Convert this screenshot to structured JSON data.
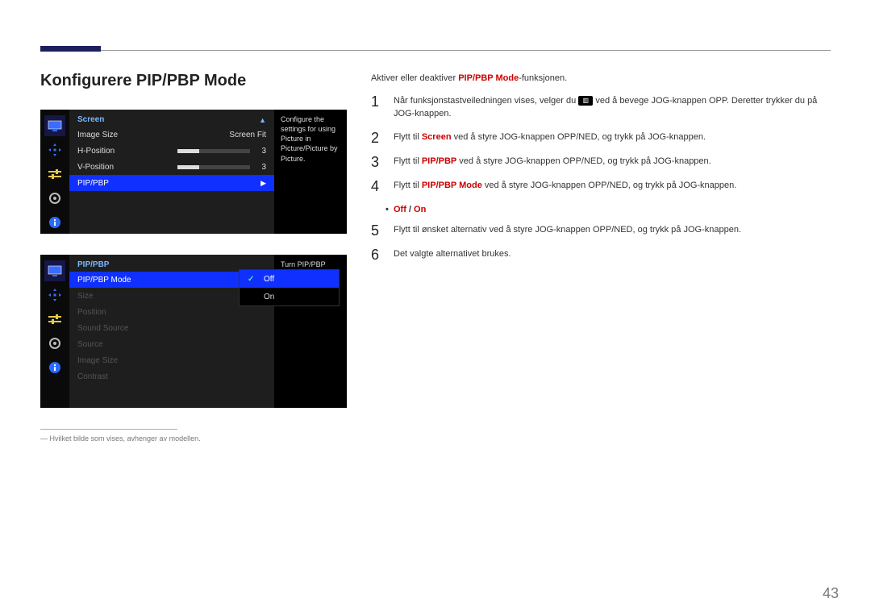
{
  "title": "Konfigurere PIP/PBP Mode",
  "osd1": {
    "header": "Screen",
    "rows": [
      {
        "label": "Image Size",
        "value": "Screen Fit"
      },
      {
        "label": "H-Position",
        "valueNum": "3"
      },
      {
        "label": "V-Position",
        "valueNum": "3"
      },
      {
        "label": "PIP/PBP",
        "highlight": true
      }
    ],
    "desc": "Configure the settings for using Picture in Picture/Picture by Picture."
  },
  "osd2": {
    "header": "PIP/PBP",
    "rows": [
      {
        "label": "PIP/PBP Mode",
        "highlight": true
      },
      {
        "label": "Size",
        "disabled": true
      },
      {
        "label": "Position",
        "disabled": true
      },
      {
        "label": "Sound Source",
        "disabled": true
      },
      {
        "label": "Source",
        "disabled": true
      },
      {
        "label": "Image Size",
        "disabled": true
      },
      {
        "label": "Contrast",
        "disabled": true
      }
    ],
    "popup": {
      "selected": "Off",
      "other": "On"
    },
    "desc": "Turn PIP/PBP Mode on or off."
  },
  "footnote": "― Hvilket bilde som vises, avhenger av modellen.",
  "instructions": {
    "intro_pre": "Aktiver eller deaktiver ",
    "intro_hl": "PIP/PBP Mode",
    "intro_post": "-funksjonen.",
    "step1_pre": "Når funksjonstastveiledningen vises, velger du ",
    "step1_post": " ved å bevege JOG-knappen OPP. Deretter trykker du på JOG-knappen.",
    "step2_pre": "Flytt til ",
    "step2_hl": "Screen",
    "step2_post": " ved å styre JOG-knappen OPP/NED, og trykk på JOG-knappen.",
    "step3_pre": "Flytt til ",
    "step3_hl": "PIP/PBP",
    "step3_post": " ved å styre JOG-knappen OPP/NED, og trykk på JOG-knappen.",
    "step4_pre": "Flytt til ",
    "step4_hl": "PIP/PBP Mode",
    "step4_post": " ved å styre JOG-knappen OPP/NED, og trykk på JOG-knappen.",
    "bullet_off": "Off",
    "bullet_slash": " / ",
    "bullet_on": "On",
    "step5": "Flytt til ønsket alternativ ved å styre JOG-knappen OPP/NED, og trykk på JOG-knappen.",
    "step6": "Det valgte alternativet brukes."
  },
  "pagenum": "43"
}
